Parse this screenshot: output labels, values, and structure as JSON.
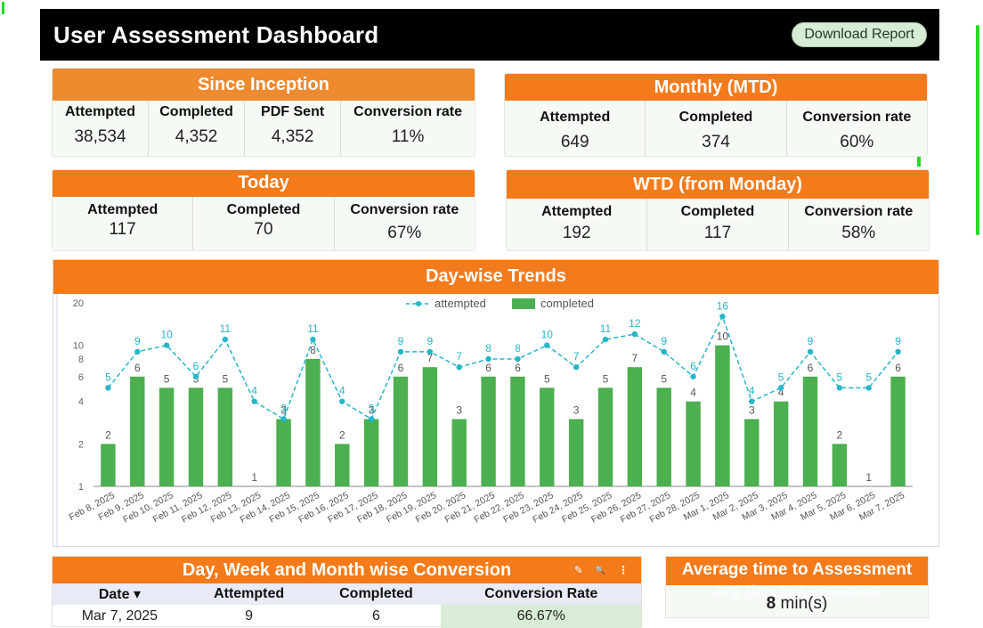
{
  "header": {
    "title": "User Assessment Dashboard",
    "download_label": "Download Report"
  },
  "since_inception": {
    "title": "Since Inception",
    "cols": [
      {
        "label": "Attempted",
        "value": "38,534"
      },
      {
        "label": "Completed",
        "value": "4,352"
      },
      {
        "label": "PDF Sent",
        "value": "4,352"
      },
      {
        "label": "Conversion rate",
        "value": "11%"
      }
    ]
  },
  "monthly": {
    "title": "Monthly (MTD)",
    "cols": [
      {
        "label": "Attempted",
        "value": "649"
      },
      {
        "label": "Completed",
        "value": "374"
      },
      {
        "label": "Conversion rate",
        "value": "60%"
      }
    ]
  },
  "today": {
    "title": "Today",
    "cols": [
      {
        "label": "Attempted",
        "value": "117"
      },
      {
        "label": "Completed",
        "value": "70"
      },
      {
        "label": "Conversion rate",
        "value": "67%"
      }
    ]
  },
  "wtd": {
    "title": "WTD (from Monday)",
    "cols": [
      {
        "label": "Attempted",
        "value": "192"
      },
      {
        "label": "Completed",
        "value": "117"
      },
      {
        "label": "Conversion rate",
        "value": "58%"
      }
    ]
  },
  "trends": {
    "title": "Day-wise Trends"
  },
  "chart_data": {
    "type": "bar",
    "title": "Day-wise Trends",
    "y_scale": "log",
    "y_ticks": [
      1,
      2,
      4,
      6,
      8,
      10,
      20
    ],
    "ylim": [
      1,
      20
    ],
    "grid": false,
    "legend": "top-center",
    "categories": [
      "Feb 8, 2025",
      "Feb 9, 2025",
      "Feb 10, 2025",
      "Feb 11, 2025",
      "Feb 12, 2025",
      "Feb 13, 2025",
      "Feb 14, 2025",
      "Feb 15, 2025",
      "Feb 16, 2025",
      "Feb 17, 2025",
      "Feb 18, 2025",
      "Feb 19, 2025",
      "Feb 20, 2025",
      "Feb 21, 2025",
      "Feb 22, 2025",
      "Feb 23, 2025",
      "Feb 24, 2025",
      "Feb 25, 2025",
      "Feb 26, 2025",
      "Feb 27, 2025",
      "Feb 28, 2025",
      "Mar 1, 2025",
      "Mar 2, 2025",
      "Mar 3, 2025",
      "Mar 4, 2025",
      "Mar 5, 2025",
      "Mar 6, 2025",
      "Mar 7, 2025"
    ],
    "series": [
      {
        "name": "attempted",
        "type": "line",
        "color": "#26b5c9",
        "values": [
          5,
          9,
          10,
          6,
          11,
          4,
          3,
          11,
          4,
          3,
          9,
          9,
          7,
          8,
          8,
          10,
          7,
          11,
          12,
          9,
          6,
          16,
          4,
          5,
          9,
          5,
          5,
          9
        ]
      },
      {
        "name": "completed",
        "type": "bar",
        "color": "#4caf50",
        "values": [
          2,
          6,
          5,
          5,
          5,
          1,
          3,
          8,
          2,
          3,
          6,
          7,
          3,
          6,
          6,
          5,
          3,
          5,
          7,
          5,
          4,
          10,
          3,
          4,
          6,
          2,
          1,
          6
        ]
      }
    ]
  },
  "conversion": {
    "title": "Day, Week and Month wise Conversion",
    "columns": [
      "Date ▾",
      "Attempted",
      "Completed",
      "Conversion Rate"
    ],
    "rows": [
      {
        "date": "Mar 7, 2025",
        "attempted": "9",
        "completed": "6",
        "rate": "66.67%"
      }
    ],
    "tools": [
      "✎",
      "🔍",
      "⋮"
    ]
  },
  "avg_time": {
    "title": "Average time to Assessment",
    "subtitle": "Avg Time to Assessment",
    "value": "8",
    "unit": "min(s)"
  }
}
